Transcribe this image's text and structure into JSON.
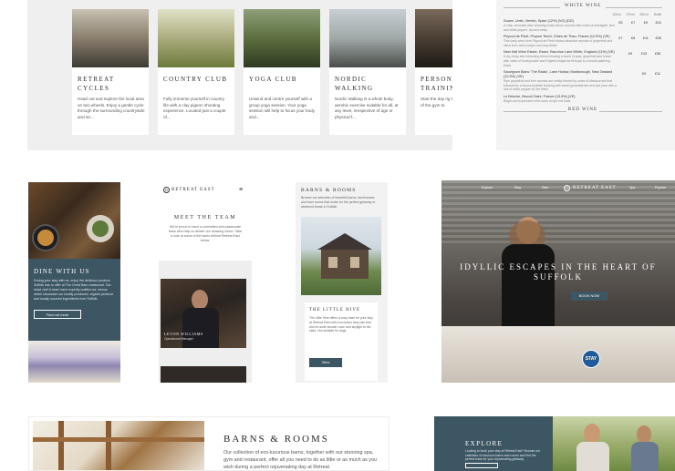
{
  "cards": [
    {
      "title": "RETREAT\nCYCLES",
      "text": "Head out and explore the local area on two wheels. Enjoy a gentle cycle through the surrounding countryside and an..."
    },
    {
      "title": "COUNTRY CLUB",
      "text": "Fully immerse yourself in country life with a clay pigeon shooting experience. Located just a couple of..."
    },
    {
      "title": "YOGA CLUB",
      "text": "Unwind and centre yourself with a group yoga session. Your yoga session will help to focus your body and..."
    },
    {
      "title": "NORDIC\nWALKING",
      "text": "Nordic Walking is a whole body, aerobic exercise suitable for all, at any level, irrespective of age or physical f..."
    },
    {
      "title": "PERSON\nTRAININ",
      "text": "Start the day rig tailored person out of the gym to"
    }
  ],
  "wine_list": {
    "white_heading": "WHITE WINE",
    "red_heading": "RED WINE",
    "col_headers": [
      "125 ml",
      "175 ml",
      "250 ml",
      "Bottle"
    ],
    "wines": [
      {
        "name": "Soave, Unito, Veneto, Spain (12%) (VG) (DG)",
        "desc": "A crisp, aromatic wine showing lovely lemon aromas with notes of pineapple, lime and white pepper, dry and zesty.",
        "prices": [
          "£5",
          "£7",
          "£9",
          "£24"
        ]
      },
      {
        "name": "Picpoul de Pinet, Picpoul Terret, Côtes de Thau, France (12.5%) (VE)",
        "desc": "This lively wine from Picpoul de Pinet shows attractive aromas of grapefruit and citrus fruit, with a bright and crisp finish.",
        "prices": [
          "£7",
          "£8",
          "£11",
          "£28"
        ]
      },
      {
        "name": "New Hall Wine Estate, Essex, Bacchus Lane White, England (11%) (VE)",
        "desc": "A dry, fruity and refreshing blend showing a touch of pear, grapefruit and lemon with notes of honeysuckle and English hedgerow through to a mouth-watering finish.",
        "prices": [
          "£9",
          "£13",
          "£35"
        ]
      },
      {
        "name": "Sauvignon Blanc 'The Radio', Lane Hollow, Marlborough, New Zealand (12.5%) (VE)",
        "desc": "Ripe grapefruit and lime aromas are neatly framed by notes of blackcurrant leaf followed by a focused palate bursting with sweet gooseberries and ripe pear with a hint of white pepper on the finish.",
        "prices": [
          "£9",
          "£11"
        ]
      },
      {
        "name": "Le Brioche, Brocoli Saint, France (13.5%) (VE)",
        "desc": "Bright and expressive with notes of ripe red fruits",
        "prices": []
      }
    ]
  },
  "dine": {
    "heading": "DINE WITH US",
    "text": "During your stay with us, enjoy the delicious produce Suffolk has to offer at The Great Barn restaurant. Our head chef & team have expertly crafted our menus which showcase our locally produced, organic produce and locally sourced ingredients from Suffolk.",
    "button": "Find out more"
  },
  "team": {
    "logo": "RETREAT EAST",
    "heading": "MEET THE TEAM",
    "text": "We're proud to have a committed and passionate team who help us deliver our amazing vision. Take a look at some of the faces behind Retreat East below.",
    "person_name": "LEVON WILLIAMS",
    "person_role": "Operational Manager"
  },
  "barns_mobile": {
    "heading": "BARNS & ROOMS",
    "text": "Browse our selection of beautiful barns, farmhouses and barn rooms that make for the perfect getaway or weekend break in Suffolk.",
    "card_title": "THE LITTLE HIVE",
    "card_text": "The Little Hive offers a cosy base for your stay at Retreat East with a luxurious king size bed and en-suite shower room and skylight to the stars. Not suitable for dogs",
    "button": "View"
  },
  "hero": {
    "nav": [
      "Explore",
      "Stay",
      "Dine",
      "Spa",
      "Explore"
    ],
    "logo": "RETREAT EAST",
    "headline_line1": "IDYLLIC ESCAPES IN THE HEART OF",
    "headline_line2": "SUFFOLK",
    "button": "BOOK NOW",
    "badge": "STAY"
  },
  "barns_desktop": {
    "heading": "BARNS & ROOMS",
    "text": "Our collection of eco-luxurious barns, together with our stunning spa, gym and restaurant, offer all you need to do as little or as much as you wish during a perfect rejuvenating day at Retreat"
  },
  "explore": {
    "heading": "EXPLORE",
    "text": "Looking to book your stay at Retreat East? Browse our collection of luxurious barns and rooms and find the perfect base for your rejuvenating getaway."
  },
  "colors": {
    "teal": "#3c5663",
    "bg_grey": "#f0f0f0"
  }
}
